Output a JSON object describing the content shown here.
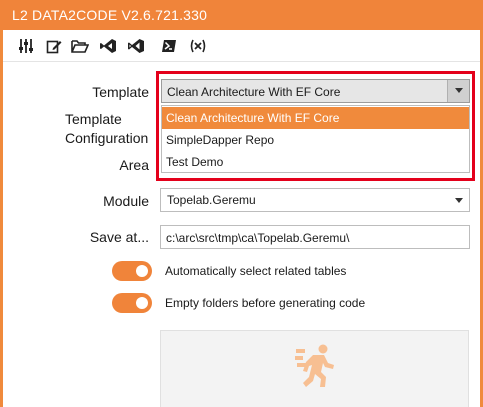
{
  "window": {
    "title": "L2 DATA2CODE V2.6.721.330"
  },
  "toolbar": {
    "buttons": [
      {
        "icon": "sliders-icon",
        "name": "settings"
      },
      {
        "icon": "edit-icon",
        "name": "edit"
      },
      {
        "icon": "folder-open-icon",
        "name": "open-folder"
      },
      {
        "icon": "visual-studio-icon",
        "name": "visual-studio"
      },
      {
        "icon": "vscode-icon",
        "name": "vs-code"
      },
      {
        "icon": "powershell-icon",
        "name": "powershell"
      },
      {
        "icon": "variables-icon",
        "name": "variables"
      }
    ]
  },
  "form": {
    "template_label": "Template",
    "template_value": "Clean Architecture With EF Core",
    "template_options": [
      "Clean Architecture With EF Core",
      "SimpleDapper Repo",
      "Test Demo"
    ],
    "template_config_label_1": "Template",
    "template_config_label_2": "Configuration",
    "area_label": "Area",
    "module_label": "Module",
    "module_value": "Topelab.Geremu",
    "save_at_label": "Save at...",
    "save_at_value": "c:\\arc\\src\\tmp\\ca\\Topelab.Geremu\\"
  },
  "toggles": [
    {
      "label": "Automatically select related tables",
      "on": true
    },
    {
      "label": "Empty folders before generating code",
      "on": true
    }
  ],
  "run_panel": {
    "icon": "running-person-icon"
  },
  "colors": {
    "accent": "#f0843a",
    "selection": "#f08a3c",
    "highlight_border": "#e4001b"
  }
}
